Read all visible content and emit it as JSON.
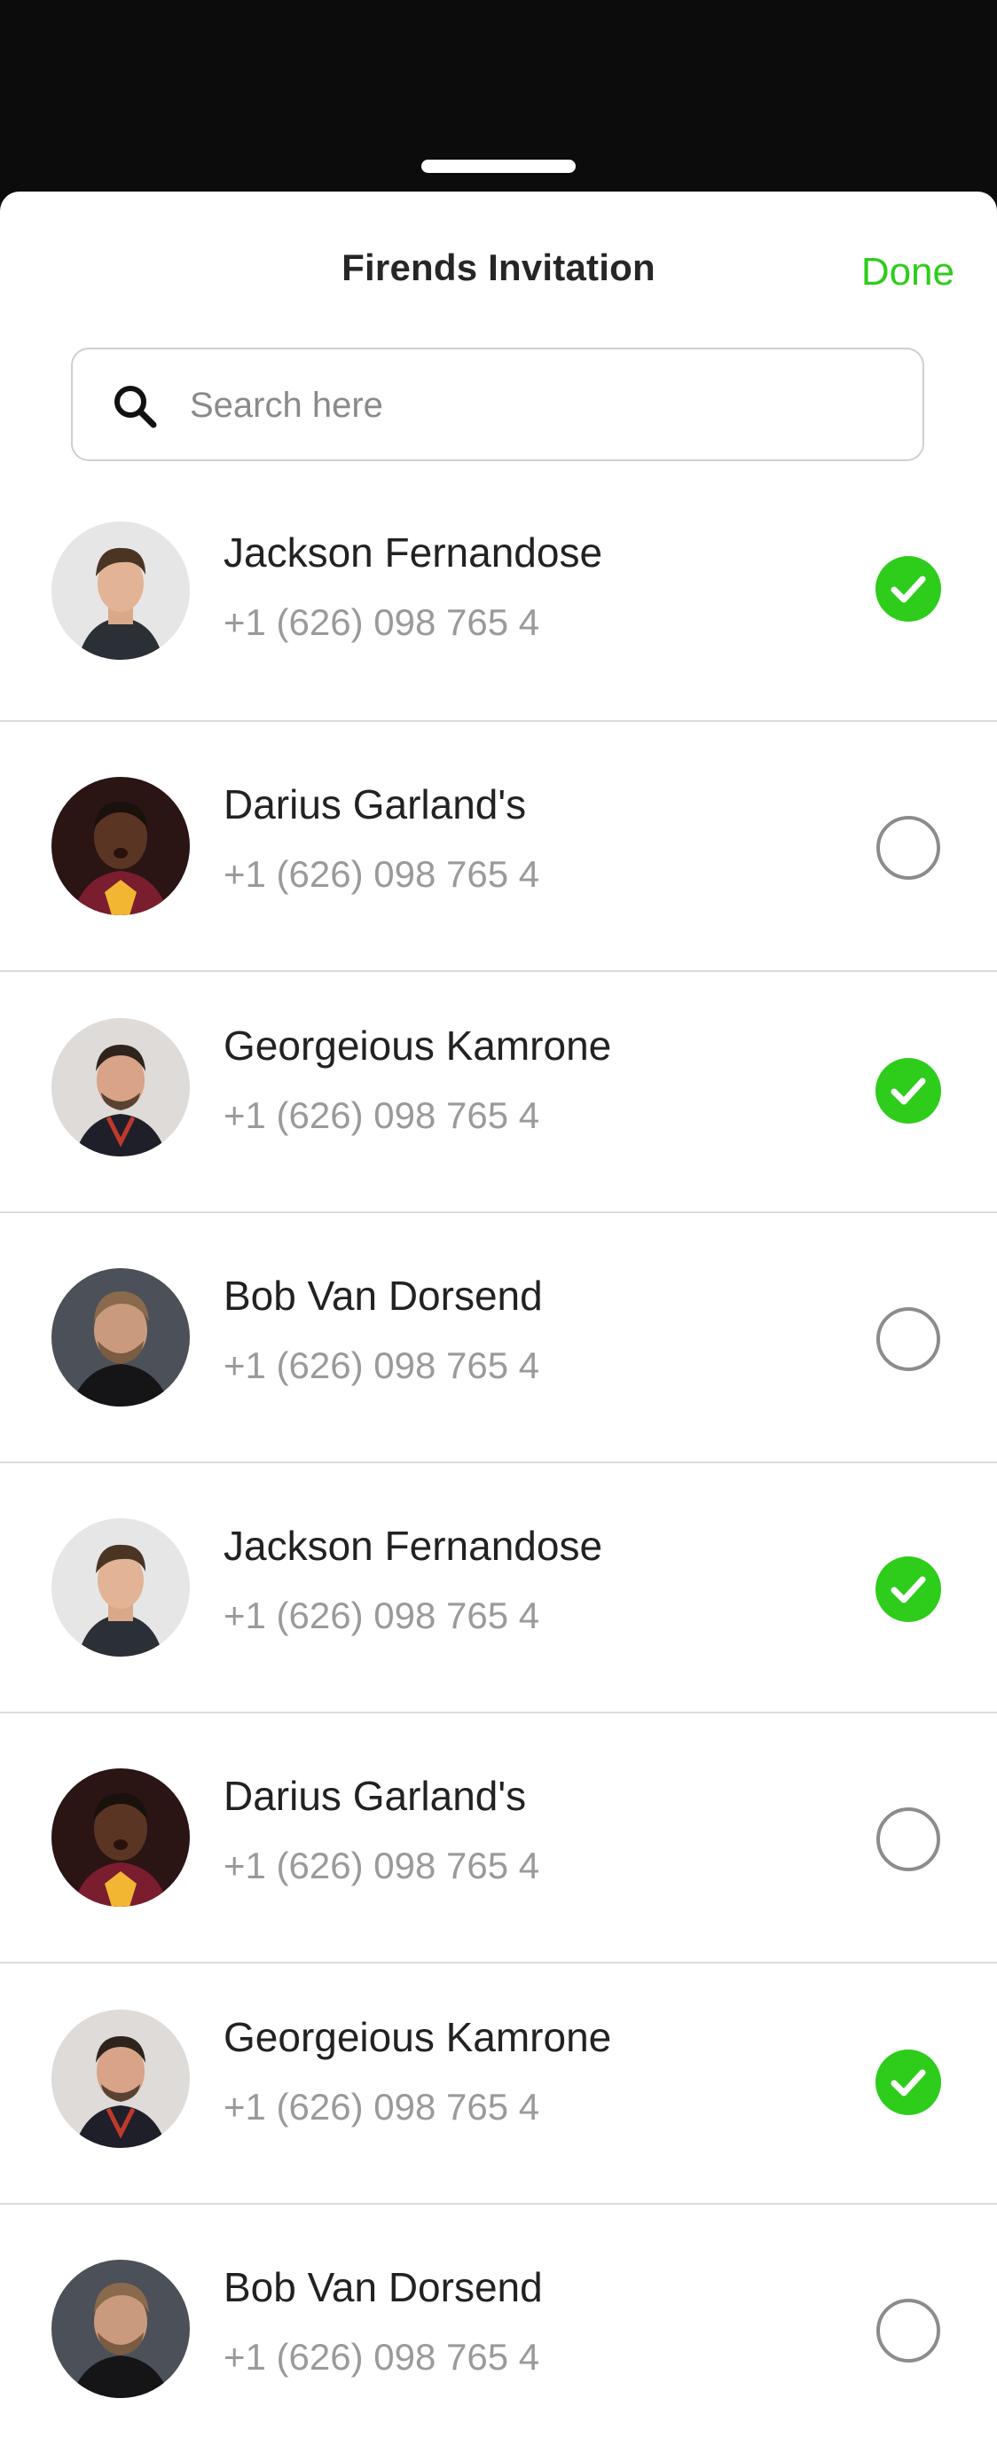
{
  "header": {
    "title": "Firends Invitation",
    "done_label": "Done"
  },
  "search": {
    "placeholder": "Search here",
    "value": ""
  },
  "colors": {
    "accent": "#2ecc1b",
    "phone_text": "#9a9a9a",
    "name_text": "#222222"
  },
  "contacts": [
    {
      "name": "Jackson Fernandose",
      "phone": "+1 (626) 098 765 4",
      "selected": true,
      "avatar": "avatar-jackson"
    },
    {
      "name": "Darius Garland's",
      "phone": "+1 (626) 098 765 4",
      "selected": false,
      "avatar": "avatar-darius"
    },
    {
      "name": "Georgeious Kamrone",
      "phone": "+1 (626) 098 765 4",
      "selected": true,
      "avatar": "avatar-georgeious"
    },
    {
      "name": "Bob Van Dorsend",
      "phone": "+1 (626) 098 765 4",
      "selected": false,
      "avatar": "avatar-bob"
    },
    {
      "name": "Jackson Fernandose",
      "phone": "+1 (626) 098 765 4",
      "selected": true,
      "avatar": "avatar-jackson"
    },
    {
      "name": "Darius Garland's",
      "phone": "+1 (626) 098 765 4",
      "selected": false,
      "avatar": "avatar-darius"
    },
    {
      "name": "Georgeious Kamrone",
      "phone": "+1 (626) 098 765 4",
      "selected": true,
      "avatar": "avatar-georgeious"
    },
    {
      "name": "Bob Van Dorsend",
      "phone": "+1 (626) 098 765 4",
      "selected": false,
      "avatar": "avatar-bob"
    }
  ]
}
